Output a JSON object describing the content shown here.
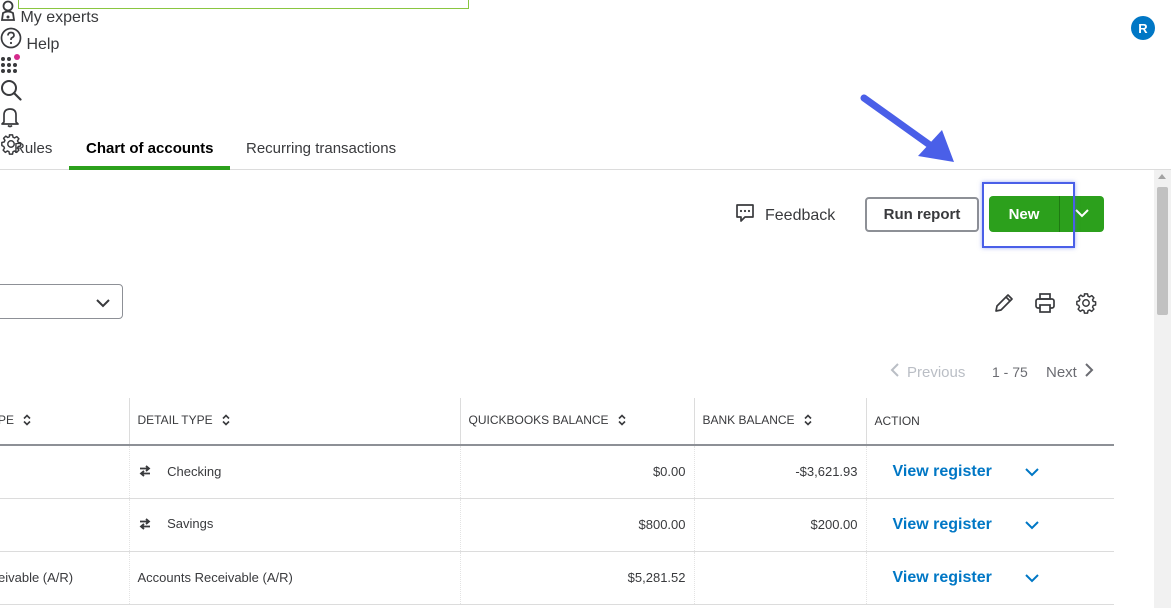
{
  "topnav": {
    "my_experts": "My experts",
    "help": "Help",
    "avatar_initial": "R"
  },
  "tabs": [
    {
      "label": "Rules"
    },
    {
      "label": "Chart of accounts"
    },
    {
      "label": "Recurring transactions"
    }
  ],
  "toolbar": {
    "feedback": "Feedback",
    "run_report": "Run report",
    "new": "New"
  },
  "pager": {
    "previous": "Previous",
    "range": "1 - 75",
    "next": "Next"
  },
  "table": {
    "headers": {
      "type": "PE",
      "detail_type": "DETAIL TYPE",
      "qb_balance": "QUICKBOOKS BALANCE",
      "bank_balance": "BANK BALANCE",
      "action": "ACTION"
    },
    "rows": [
      {
        "type": "",
        "detail_type": "Checking",
        "qb_balance": "$0.00",
        "bank_balance": "-$3,621.93",
        "action": "View register"
      },
      {
        "type": "",
        "detail_type": "Savings",
        "qb_balance": "$800.00",
        "bank_balance": "$200.00",
        "action": "View register"
      },
      {
        "type": "eivable (A/R)",
        "detail_type": "Accounts Receivable (A/R)",
        "qb_balance": "$5,281.52",
        "bank_balance": "",
        "action": "View register"
      }
    ]
  },
  "colors": {
    "accent_green": "#2ca01c",
    "link_blue": "#0077c5",
    "highlight_blue": "#4a5fe8"
  }
}
